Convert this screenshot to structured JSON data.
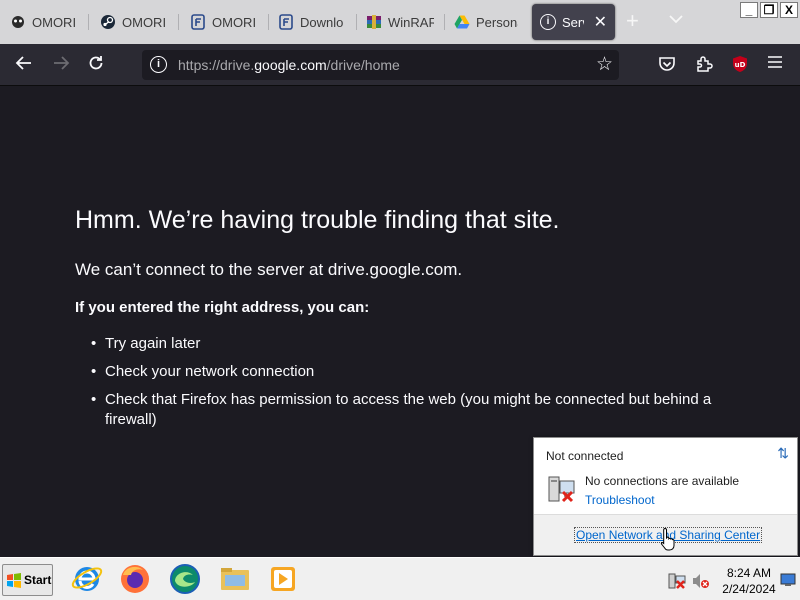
{
  "tabs": [
    {
      "title": "OMORI |",
      "icon": "omori-icon"
    },
    {
      "title": "OMORI",
      "icon": "steam-icon"
    },
    {
      "title": "OMORI",
      "icon": "file-icon"
    },
    {
      "title": "Downlo",
      "icon": "file-icon"
    },
    {
      "title": "WinRAR",
      "icon": "winrar-icon"
    },
    {
      "title": "Persona",
      "icon": "google-drive-icon"
    },
    {
      "title": "Server",
      "icon": "info-icon",
      "active": true
    }
  ],
  "window": {
    "minimize": "_",
    "restore": "❐",
    "close": "X"
  },
  "url": {
    "prefix": "https://drive.",
    "host": "google.com",
    "suffix": "/drive/home"
  },
  "error": {
    "title": "Hmm. We’re having trouble finding that site.",
    "subtitle": "We can’t connect to the server at drive.google.com.",
    "advice_heading": "If you entered the right address, you can:",
    "items": [
      "Try again later",
      "Check your network connection",
      "Check that Firefox has permission to access the web (you might be connected but behind a firewall)"
    ]
  },
  "network_popup": {
    "header": "Not connected",
    "message": "No connections are available",
    "troubleshoot": "Troubleshoot",
    "open_network": "Open Network and Sharing Center"
  },
  "taskbar": {
    "start_label": "Start",
    "apps": [
      "internet-explorer-icon",
      "firefox-icon",
      "edge-icon",
      "file-explorer-icon",
      "media-player-icon"
    ],
    "time": "8:24 AM",
    "date": "2/24/2024"
  },
  "colors": {
    "page_bg": "#1c1b22",
    "toolbar_bg": "#2b2a33",
    "tabstrip_bg": "#d6d6d8",
    "link": "#0066cc",
    "ublock": "#c4001a"
  }
}
